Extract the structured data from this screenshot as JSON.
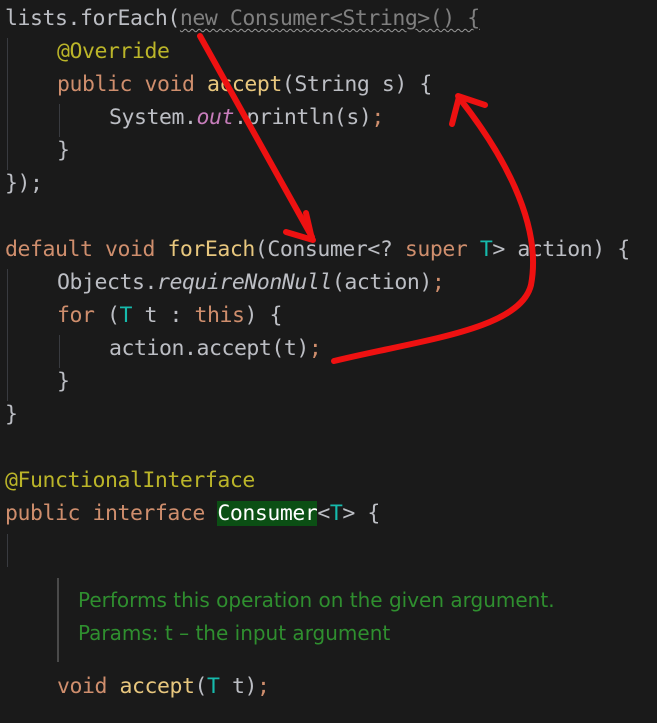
{
  "editor": {
    "background": "#1a1a1a",
    "default_text_color": "#bcbec4",
    "selection_highlight_color": "#0b4f14",
    "annotation_color": "#ee1111",
    "font_size_px": 21.5,
    "line_height_px": 33
  },
  "code": {
    "line1": {
      "call": "lists.forEach(",
      "anonymous_class": "new Consumer<String>() {"
    },
    "line2": {
      "annotation": "@Override"
    },
    "line3": {
      "modifiers": "public void ",
      "method": "accept",
      "signature": "(String s) {"
    },
    "line4": {
      "receiver": "System.",
      "field": "out",
      "dot": ".",
      "method": "println",
      "args": "(s)",
      "semi": ";"
    },
    "line5": {
      "brace": "}"
    },
    "line6": {
      "close": "});"
    },
    "line7": {
      "kw1": "default",
      "kw2": " void ",
      "method": "forEach",
      "open": "(Consumer<? ",
      "kw3": "super",
      "space": " ",
      "typeparam": "T",
      "rest": "> action) {"
    },
    "line8": {
      "receiver": "Objects.",
      "method": "requireNonNull",
      "args": "(action)",
      "semi": ";"
    },
    "line9": {
      "kw": "for",
      "open": " (",
      "typeparam": "T",
      "mid": " t : ",
      "kw2": "this",
      "close": ") {"
    },
    "line10": {
      "expr": "action.accept(t)",
      "semi": ";"
    },
    "line11": {
      "brace": "}"
    },
    "line12": {
      "brace": "}"
    },
    "line13": {
      "annotation": "@FunctionalInterface"
    },
    "line14": {
      "kw": "public interface ",
      "type_selected": "Consumer",
      "generic_open": "<",
      "typeparam": "T",
      "generic_close": "> {"
    },
    "line15": {
      "kw": "void ",
      "method": "accept",
      "open": "(",
      "typeparam": "T",
      "rest": " t)",
      "semi": ";"
    }
  },
  "javadoc": {
    "description": "Performs this operation on the given argument.",
    "params": "Params: t – the input argument"
  },
  "annotations": [
    {
      "name": "straight-arrow-to-consumer",
      "description": "red straight arrow from anonymous class declaration down to Consumer parameter in forEach"
    },
    {
      "name": "curved-arrow-to-accept",
      "description": "red curved arrow from action.accept(t) up to the accept(String s) method body"
    }
  ]
}
